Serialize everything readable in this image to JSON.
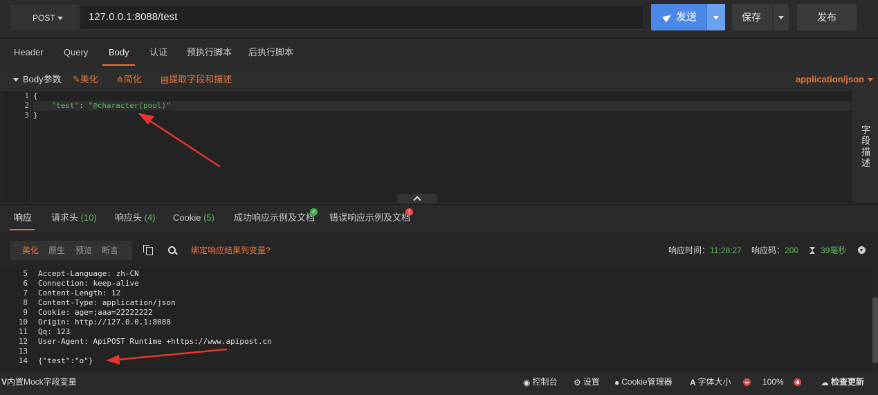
{
  "request": {
    "method": "POST",
    "url": "127.0.0.1:8088/test",
    "send_label": "发送",
    "save_label": "保存",
    "publish_label": "发布"
  },
  "request_tabs": [
    "Header",
    "Query",
    "Body",
    "认证",
    "预执行脚本",
    "后执行脚本"
  ],
  "active_request_tab": "Body",
  "body_toolbar": {
    "title": "Body参数",
    "beautify": "美化",
    "simplify": "简化",
    "extract": "提取字段和描述",
    "content_type": "application/json"
  },
  "editor": {
    "line_numbers": [
      "1",
      "2",
      "3"
    ],
    "line1": "{",
    "key": "\"test\"",
    "colon": ": ",
    "value": "\"@character(pool)\"",
    "line3": "}"
  },
  "field_desc_label": "字段描述",
  "response_tabs": {
    "response": "响应",
    "req_headers": "请求头",
    "req_headers_count": "(10)",
    "res_headers": "响应头",
    "res_headers_count": "(4)",
    "cookie": "Cookie",
    "cookie_count": "(5)",
    "success_doc": "成功响应示例及文档",
    "error_doc": "错误响应示例及文档"
  },
  "response_toolbar": {
    "views": [
      "美化",
      "原生",
      "预览",
      "断言"
    ],
    "bind_var": "绑定响应结果到变量?",
    "time_label": "响应时间：",
    "time_value": "11:28:27",
    "code_label": "响应码：",
    "code_value": "200",
    "duration": "39毫秒"
  },
  "response_body": {
    "lines": [
      {
        "n": "5",
        "text": "Accept-Language: zh-CN"
      },
      {
        "n": "6",
        "text": "Connection: keep-alive"
      },
      {
        "n": "7",
        "text": "Content-Length: 12"
      },
      {
        "n": "8",
        "text": "Content-Type: application/json"
      },
      {
        "n": "9",
        "text": "Cookie: age=;aaa=22222222"
      },
      {
        "n": "10",
        "text": "Origin: http://127.0.0.1:8088"
      },
      {
        "n": "11",
        "text": "Qq: 123"
      },
      {
        "n": "12",
        "text": "User-Agent: ApiPOST Runtime +https://www.apipost.cn"
      },
      {
        "n": "13",
        "text": ""
      },
      {
        "n": "14",
        "text": "{\"test\":\"o\"}"
      }
    ]
  },
  "footer": {
    "mock": "内置Mock字段变量",
    "console": "控制台",
    "settings": "设置",
    "cookie_manager": "Cookie管理器",
    "font_size": "字体大小",
    "zoom": "100%",
    "check_update": "检查更新"
  },
  "colors": {
    "accent": "#e8743b",
    "send_blue": "#4b89e8",
    "success_green": "#5fb760",
    "annotation_red": "#e8342c"
  }
}
